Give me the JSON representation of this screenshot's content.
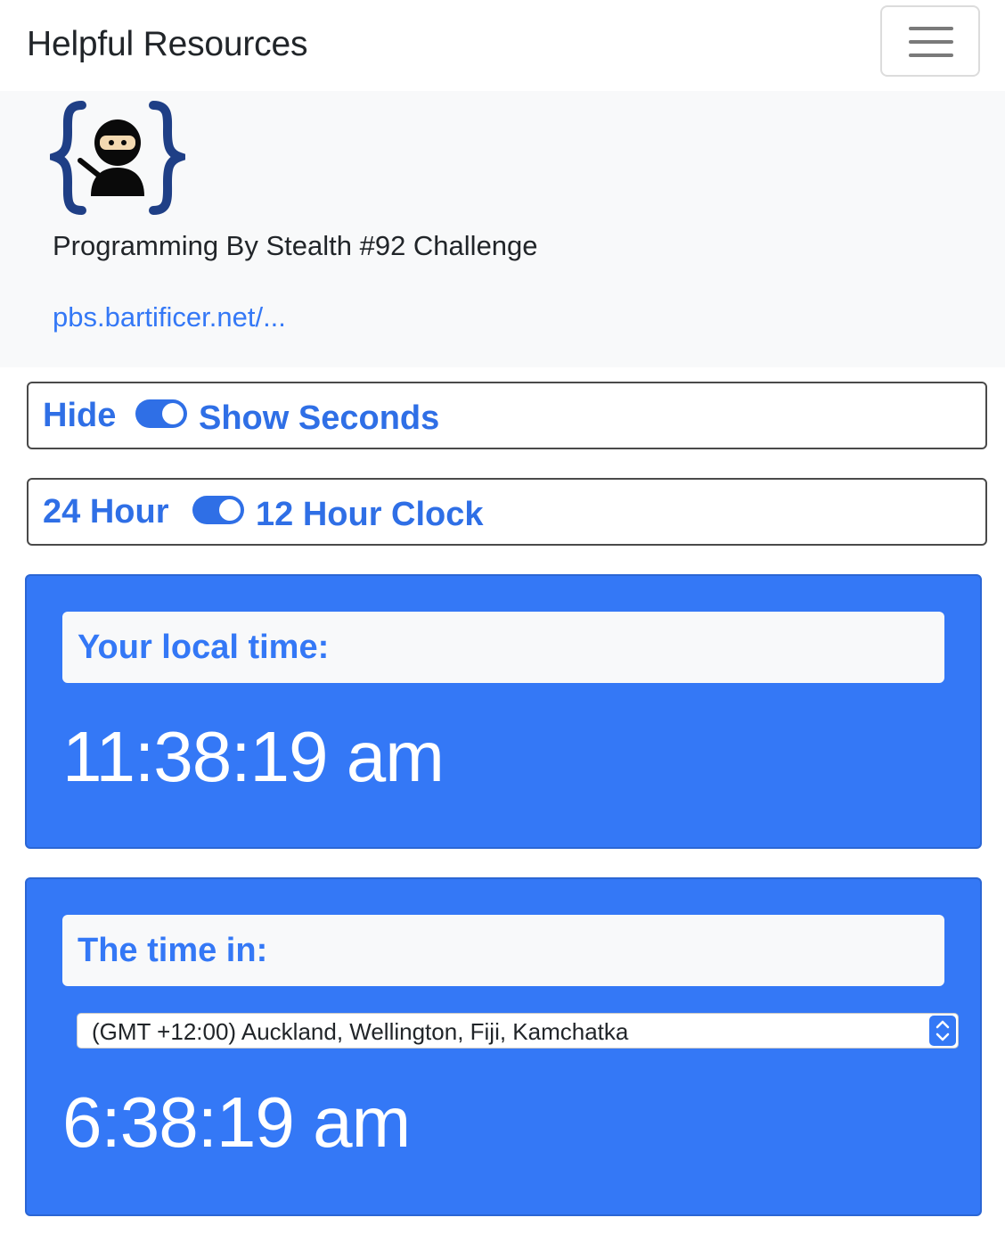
{
  "navbar": {
    "brand": "Helpful Resources",
    "menu_icon": "hamburger-menu-icon"
  },
  "header": {
    "logo_icon": "ninja-braces-logo-icon",
    "title": "Programming By Stealth #92 Challenge",
    "link_text": "pbs.bartificer.net/..."
  },
  "seconds_toggle": {
    "off_label": "Hide",
    "on_label": "Show Seconds",
    "checked": true
  },
  "clock_toggle": {
    "off_label": "24 Hour",
    "on_label": "12 Hour Clock",
    "checked": true
  },
  "local_card": {
    "heading": "Your local time:",
    "time": "11:38:19 am"
  },
  "remote_card": {
    "heading": "The time in:",
    "selected_timezone": "(GMT +12:00) Auckland, Wellington, Fiji, Kamchatka",
    "time": "6:38:19 am"
  },
  "colors": {
    "accent": "#3478f6",
    "panel": "#f8f9fa",
    "text": "#212529"
  }
}
